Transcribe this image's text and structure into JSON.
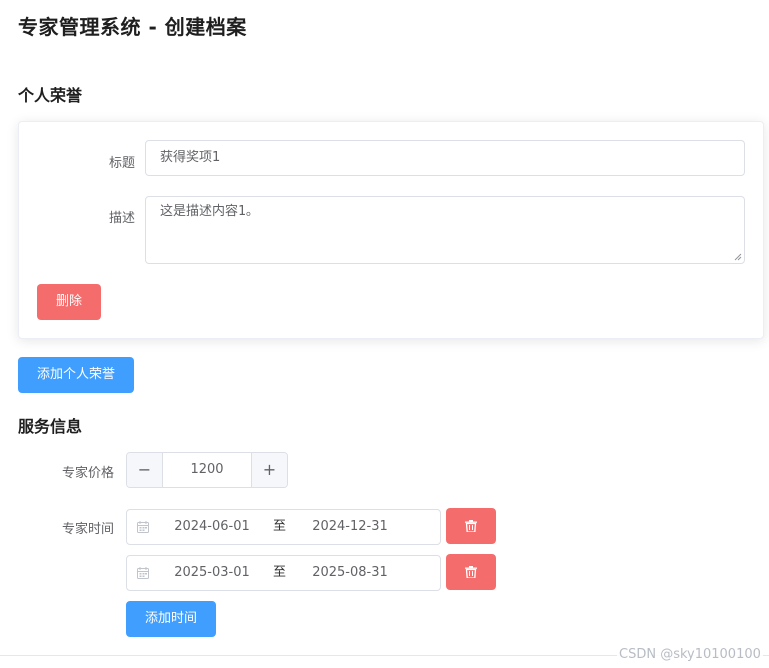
{
  "page": {
    "title": "专家管理系统 - 创建档案"
  },
  "honors": {
    "section_title": "个人荣誉",
    "items": [
      {
        "title_label": "标题",
        "title_value": "获得奖项1",
        "desc_label": "描述",
        "desc_value": "这是描述内容1。",
        "delete_label": "删除"
      }
    ],
    "add_label": "添加个人荣誉"
  },
  "service": {
    "section_title": "服务信息",
    "price_label": "专家价格",
    "price_value": "1200",
    "price_dec_symbol": "−",
    "price_inc_symbol": "+",
    "time_label": "专家时间",
    "ranges": [
      {
        "start": "2024-06-01",
        "separator": "至",
        "end": "2024-12-31"
      },
      {
        "start": "2025-03-01",
        "separator": "至",
        "end": "2025-08-31"
      }
    ],
    "add_time_label": "添加时间"
  },
  "watermark": "CSDN @sky10100100",
  "colors": {
    "primary": "#409eff",
    "danger": "#f56c6c",
    "border": "#dcdfe6",
    "text": "#606266"
  },
  "icons": [
    "calendar-icon",
    "trash-icon",
    "minus-icon",
    "plus-icon"
  ]
}
